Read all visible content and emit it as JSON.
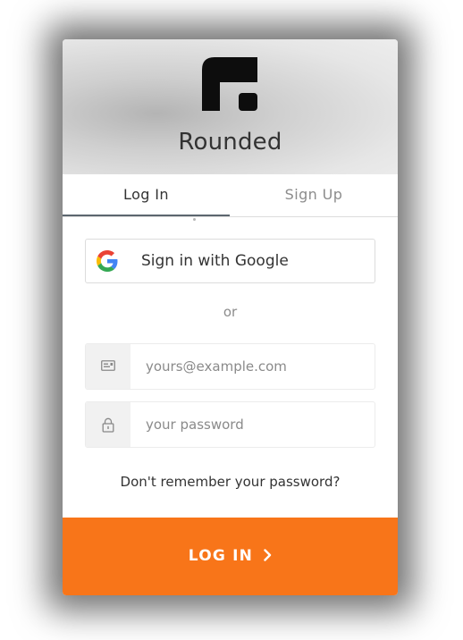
{
  "brand": {
    "name": "Rounded",
    "logo_icon": "rounded-logo-icon"
  },
  "tabs": [
    {
      "label": "Log In",
      "active": true
    },
    {
      "label": "Sign Up",
      "active": false
    }
  ],
  "social": {
    "google_label": "Sign in with Google",
    "google_icon": "google-icon"
  },
  "divider_text": "or",
  "form": {
    "email": {
      "placeholder": "yours@example.com",
      "value": "",
      "icon": "email-card-icon"
    },
    "password": {
      "placeholder": "your password",
      "value": "",
      "icon": "lock-icon"
    },
    "forgot_label": "Don't remember your password?"
  },
  "submit": {
    "label": "LOG IN",
    "icon": "chevron-right-icon"
  },
  "colors": {
    "accent": "#f87519",
    "text": "#333333",
    "muted": "#8c8c8c",
    "tab_indicator": "#5c666f"
  }
}
